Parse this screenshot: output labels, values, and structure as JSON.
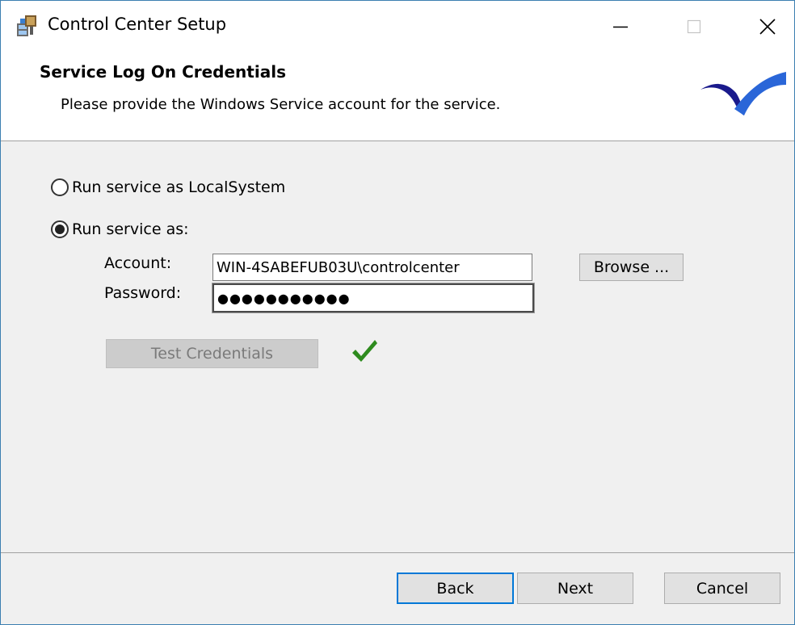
{
  "window": {
    "title": "Control Center Setup",
    "controls": {
      "minimize": "minimize-icon",
      "maximize": "maximize-icon",
      "close": "close-icon"
    }
  },
  "header": {
    "title": "Service Log On Credentials",
    "subtitle": "Please provide the Windows Service account for the service.",
    "logo_colors": [
      "#1a1a8c",
      "#2a66d8"
    ]
  },
  "options": {
    "local_system": {
      "label": "Run service as LocalSystem",
      "selected": false
    },
    "run_as": {
      "label": "Run service as:",
      "selected": true
    }
  },
  "account": {
    "label": "Account:",
    "value": "WIN-4SABEFUB03U\\controlcenter",
    "browse_label": "Browse ..."
  },
  "password": {
    "label": "Password:",
    "value": "●●●●●●●●●●●"
  },
  "test": {
    "label": "Test Credentials",
    "enabled": false,
    "result_icon": "checkmark-icon",
    "result_color": "#2e8b1e"
  },
  "footer": {
    "back_label": "Back",
    "next_label": "Next",
    "cancel_label": "Cancel"
  }
}
